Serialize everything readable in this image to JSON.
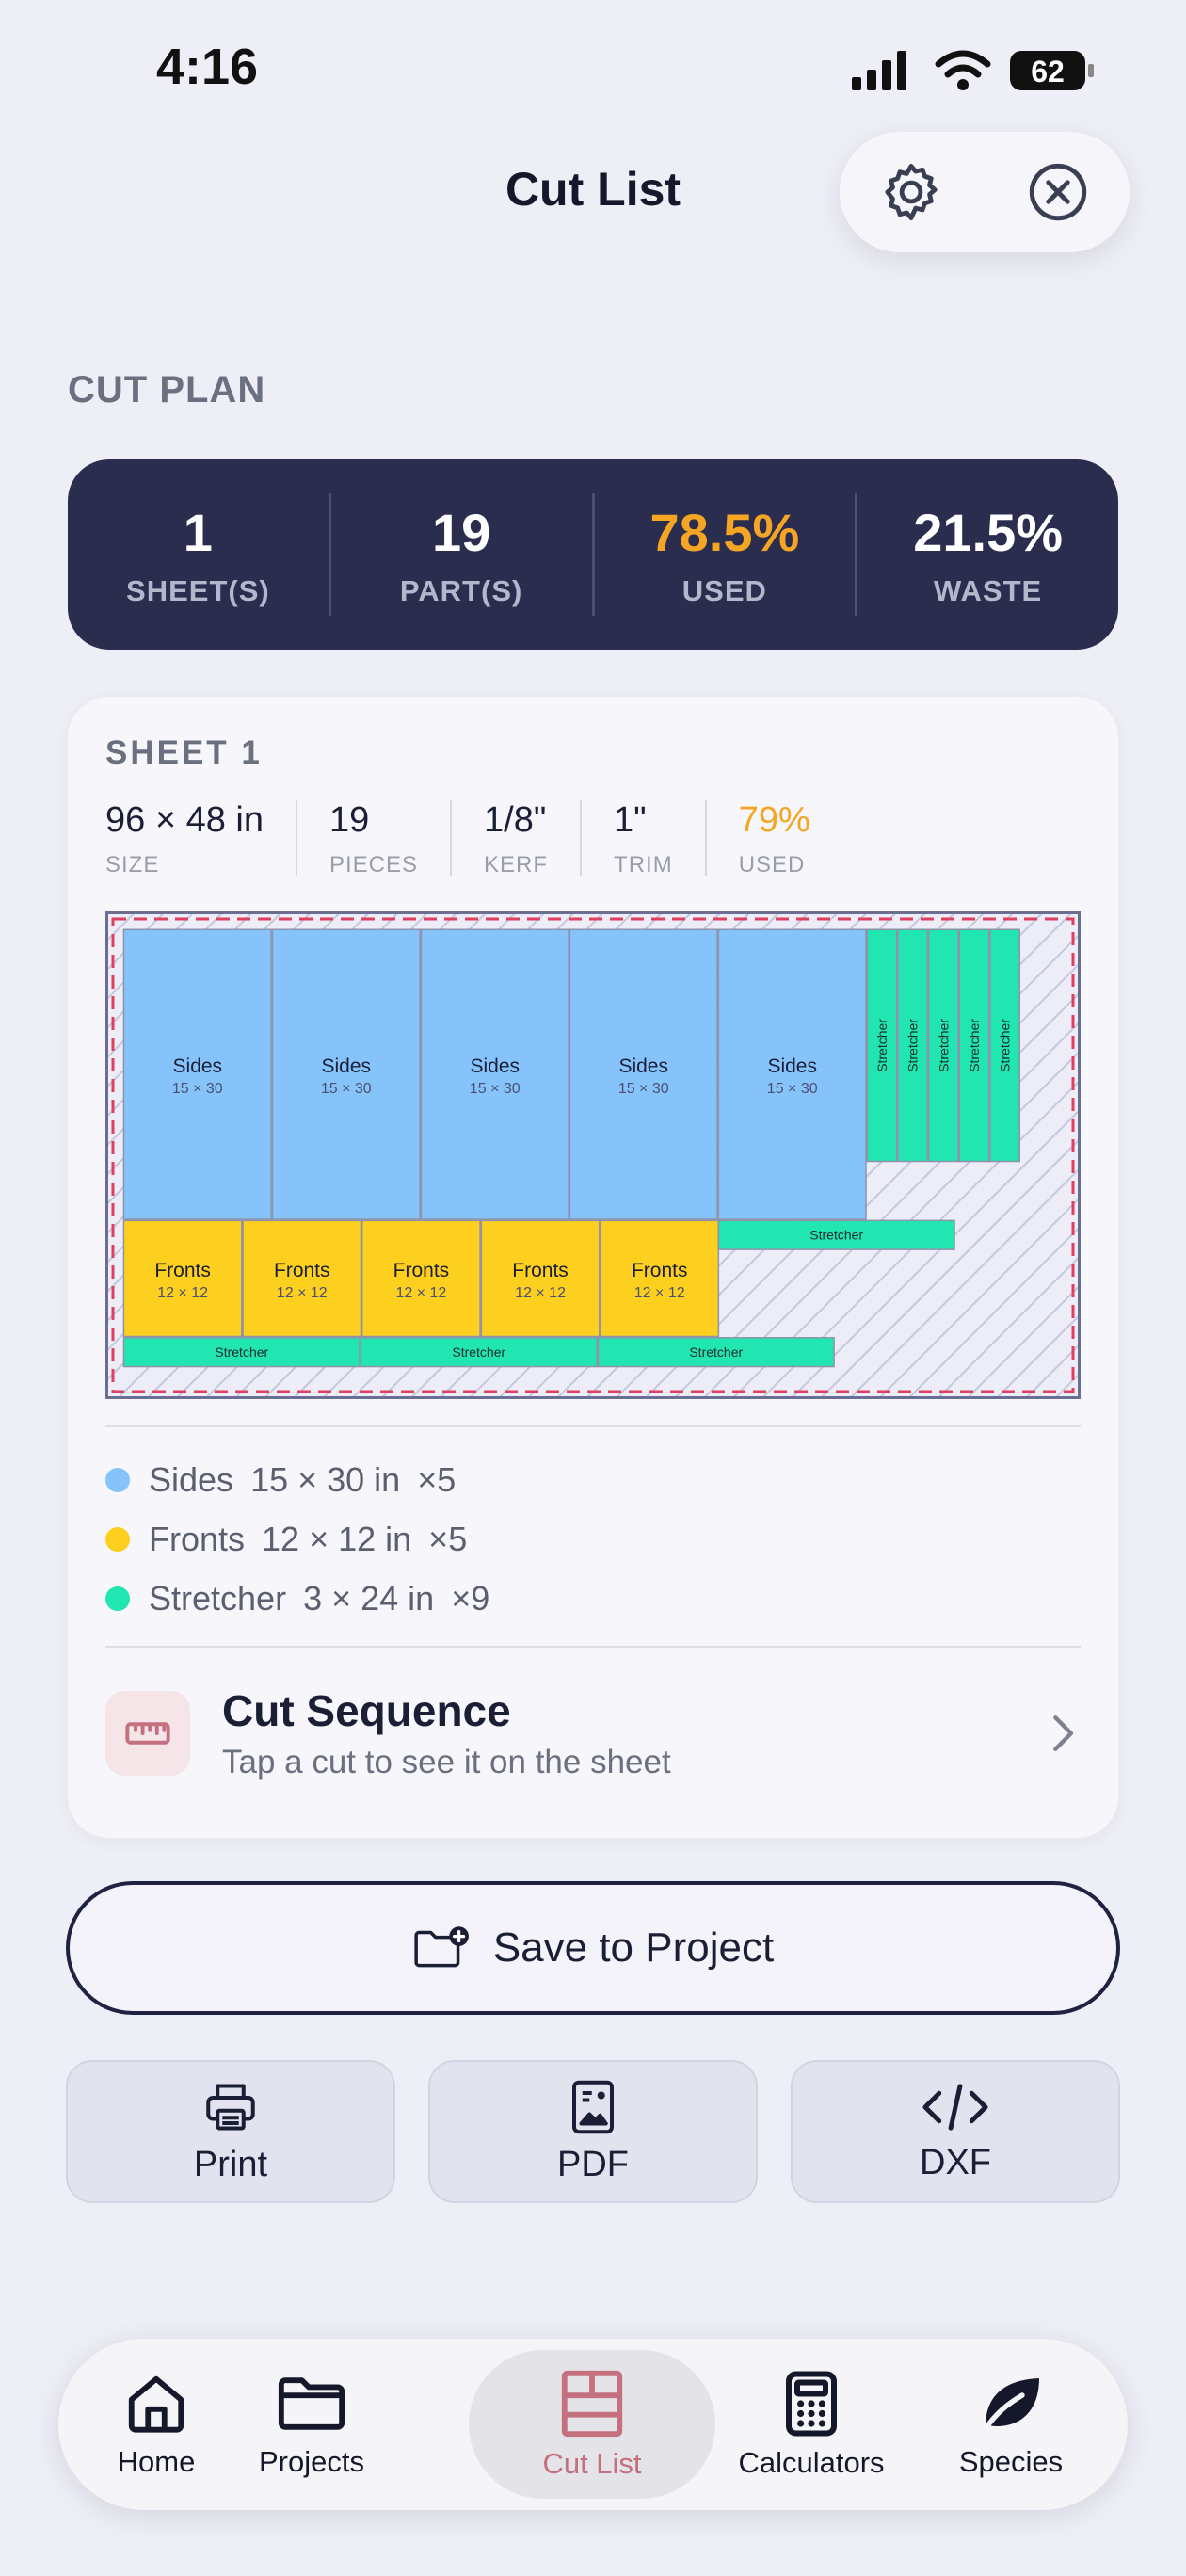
{
  "status": {
    "time": "4:16",
    "battery": "62"
  },
  "header": {
    "title": "Cut List"
  },
  "section_label": "CUT PLAN",
  "summary": [
    {
      "value": "1",
      "label": "SHEET(S)"
    },
    {
      "value": "19",
      "label": "PART(S)"
    },
    {
      "value": "78.5%",
      "label": "USED",
      "accent": "#f5a524"
    },
    {
      "value": "21.5%",
      "label": "WASTE"
    }
  ],
  "sheet": {
    "title": "SHEET 1",
    "specs": [
      {
        "value": "96 × 48 in",
        "label": "SIZE"
      },
      {
        "value": "19",
        "label": "PIECES"
      },
      {
        "value": "1/8\"",
        "label": "KERF"
      },
      {
        "value": "1\"",
        "label": "TRIM"
      },
      {
        "value": "79%",
        "label": "USED"
      }
    ],
    "layout_units": "in",
    "sheet_size": [
      96,
      48
    ],
    "parts": [
      {
        "name": "Sides",
        "dims": "15 × 30",
        "x": 0,
        "y": 0,
        "w": 15,
        "h": 30,
        "color": "#86c3fb"
      },
      {
        "name": "Sides",
        "dims": "15 × 30",
        "x": 15.125,
        "y": 0,
        "w": 15,
        "h": 30,
        "color": "#86c3fb"
      },
      {
        "name": "Sides",
        "dims": "15 × 30",
        "x": 30.25,
        "y": 0,
        "w": 15,
        "h": 30,
        "color": "#86c3fb"
      },
      {
        "name": "Sides",
        "dims": "15 × 30",
        "x": 45.375,
        "y": 0,
        "w": 15,
        "h": 30,
        "color": "#86c3fb"
      },
      {
        "name": "Sides",
        "dims": "15 × 30",
        "x": 60.5,
        "y": 0,
        "w": 15,
        "h": 30,
        "color": "#86c3fb"
      },
      {
        "name": "Stretcher",
        "dims": "",
        "x": 75.625,
        "y": 0,
        "w": 3,
        "h": 24,
        "color": "#22e6b1",
        "vertical": true
      },
      {
        "name": "Stretcher",
        "dims": "",
        "x": 78.75,
        "y": 0,
        "w": 3,
        "h": 24,
        "color": "#22e6b1",
        "vertical": true
      },
      {
        "name": "Stretcher",
        "dims": "",
        "x": 81.875,
        "y": 0,
        "w": 3,
        "h": 24,
        "color": "#22e6b1",
        "vertical": true
      },
      {
        "name": "Stretcher",
        "dims": "",
        "x": 85,
        "y": 0,
        "w": 3,
        "h": 24,
        "color": "#22e6b1",
        "vertical": true
      },
      {
        "name": "Stretcher",
        "dims": "",
        "x": 88.125,
        "y": 0,
        "w": 3,
        "h": 24,
        "color": "#22e6b1",
        "vertical": true
      },
      {
        "name": "Fronts",
        "dims": "12 × 12",
        "x": 0,
        "y": 30.125,
        "w": 12,
        "h": 12,
        "color": "#fdcf1f"
      },
      {
        "name": "Fronts",
        "dims": "12 × 12",
        "x": 12.125,
        "y": 30.125,
        "w": 12,
        "h": 12,
        "color": "#fdcf1f"
      },
      {
        "name": "Fronts",
        "dims": "12 × 12",
        "x": 24.25,
        "y": 30.125,
        "w": 12,
        "h": 12,
        "color": "#fdcf1f"
      },
      {
        "name": "Fronts",
        "dims": "12 × 12",
        "x": 36.375,
        "y": 30.125,
        "w": 12,
        "h": 12,
        "color": "#fdcf1f"
      },
      {
        "name": "Fronts",
        "dims": "12 × 12",
        "x": 48.5,
        "y": 30.125,
        "w": 12,
        "h": 12,
        "color": "#fdcf1f"
      },
      {
        "name": "Stretcher",
        "dims": "",
        "x": 60.5,
        "y": 30.125,
        "w": 24,
        "h": 3,
        "color": "#22e6b1"
      },
      {
        "name": "Stretcher",
        "dims": "",
        "x": 0,
        "y": 42.25,
        "w": 24,
        "h": 3,
        "color": "#22e6b1"
      },
      {
        "name": "Stretcher",
        "dims": "",
        "x": 24.125,
        "y": 42.25,
        "w": 24,
        "h": 3,
        "color": "#22e6b1"
      },
      {
        "name": "Stretcher",
        "dims": "",
        "x": 48.25,
        "y": 42.25,
        "w": 24,
        "h": 3,
        "color": "#22e6b1"
      }
    ],
    "legend": [
      {
        "name": "Sides",
        "dims": "15 × 30 in",
        "qty": "×5",
        "color": "#86c3fb"
      },
      {
        "name": "Fronts",
        "dims": "12 × 12 in",
        "qty": "×5",
        "color": "#fdcf1f"
      },
      {
        "name": "Stretcher",
        "dims": "3 × 24 in",
        "qty": "×9",
        "color": "#22e6b1"
      }
    ],
    "sequence": {
      "title": "Cut Sequence",
      "subtitle": "Tap a cut to see it on the sheet"
    }
  },
  "actions": {
    "save": "Save to Project",
    "print": "Print",
    "pdf": "PDF",
    "dxf": "DXF"
  },
  "tabs": [
    {
      "label": "Home",
      "icon": "home-icon"
    },
    {
      "label": "Projects",
      "icon": "folder-icon"
    },
    {
      "label": "Cut List",
      "icon": "cut-list-icon",
      "active": true
    },
    {
      "label": "Calculators",
      "icon": "calculator-icon"
    },
    {
      "label": "Species",
      "icon": "leaf-icon"
    }
  ],
  "colors": {
    "accent": "#c4707e",
    "navy": "#2a2d4e",
    "used": "#f5a524"
  }
}
